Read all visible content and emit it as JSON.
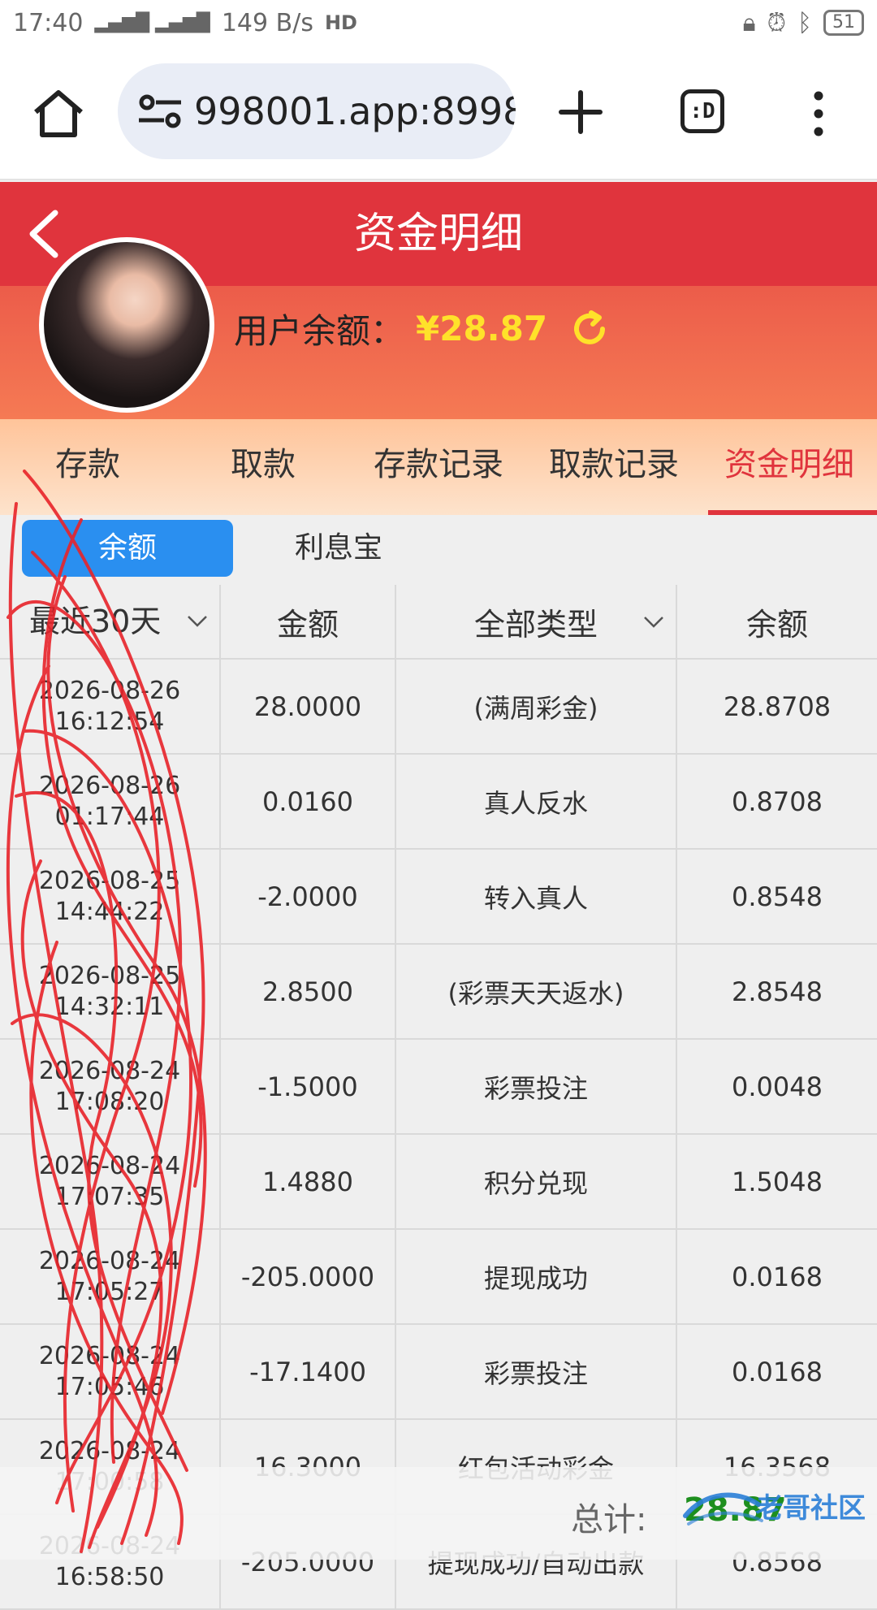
{
  "status_bar": {
    "time": "17:40",
    "network": "4G 4G",
    "speed": "149 B/s",
    "hd": "HD",
    "battery": "51"
  },
  "browser": {
    "url": "998001.app:8998"
  },
  "header": {
    "title": "资金明细"
  },
  "profile": {
    "balance_label": "用户余额：",
    "balance_value": "¥28.87"
  },
  "tabs": [
    {
      "label": "存款"
    },
    {
      "label": "取款"
    },
    {
      "label": "存款记录"
    },
    {
      "label": "取款记录"
    },
    {
      "label": "资金明细"
    }
  ],
  "subtabs": {
    "active": "余额",
    "other": "利息宝"
  },
  "table": {
    "headers": {
      "date": "最近30天",
      "amount": "金额",
      "type": "全部类型",
      "balance": "余额"
    },
    "rows": [
      {
        "date": "2026-08-26",
        "time": "16:12:54",
        "amount": "28.0000",
        "type": "(满周彩金)",
        "balance": "28.8708"
      },
      {
        "date": "2026-08-26",
        "time": "01:17:44",
        "amount": "0.0160",
        "type": "真人反水",
        "balance": "0.8708"
      },
      {
        "date": "2026-08-25",
        "time": "14:44:22",
        "amount": "-2.0000",
        "type": "转入真人",
        "balance": "0.8548"
      },
      {
        "date": "2026-08-25",
        "time": "14:32:11",
        "amount": "2.8500",
        "type": "(彩票天天返水)",
        "balance": "2.8548"
      },
      {
        "date": "2026-08-24",
        "time": "17:08:20",
        "amount": "-1.5000",
        "type": "彩票投注",
        "balance": "0.0048"
      },
      {
        "date": "2026-08-24",
        "time": "17:07:35",
        "amount": "1.4880",
        "type": "积分兑现",
        "balance": "1.5048"
      },
      {
        "date": "2026-08-24",
        "time": "17:05:27",
        "amount": "-205.0000",
        "type": "提现成功",
        "balance": "0.0168"
      },
      {
        "date": "2026-08-24",
        "time": "17:05:46",
        "amount": "-17.1400",
        "type": "彩票投注",
        "balance": "0.0168"
      },
      {
        "date": "2026-08-24",
        "time": "17:00:58",
        "amount": "16.3000",
        "type": "红包活动彩金",
        "balance": "16.3568"
      },
      {
        "date": "2026-08-24",
        "time": "16:58:50",
        "amount": "-205.0000",
        "type": "提现成功/自动出款",
        "balance": "0.8568"
      }
    ]
  },
  "footer": {
    "total_label": "总计:",
    "total_value": "28.87",
    "watermark": "老哥社区"
  },
  "colors": {
    "header_red": "#e0343d",
    "balance_yellow": "#ffe12a",
    "active_blue": "#2a8ff0",
    "total_green": "#1e8f1e"
  }
}
